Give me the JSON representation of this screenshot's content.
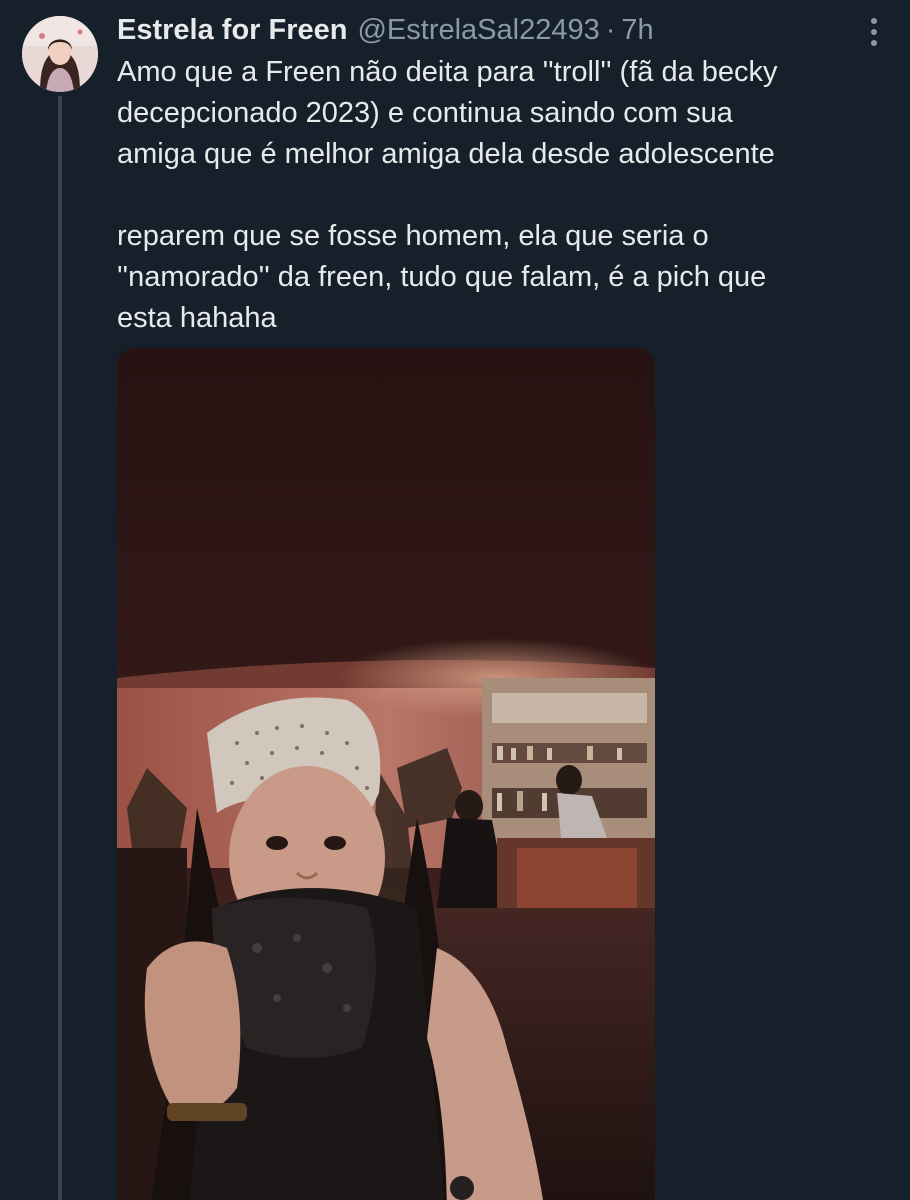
{
  "tweet": {
    "author": {
      "display_name": "Estrela for Freen",
      "handle": "@EstrelaSal22493",
      "separator": "·",
      "time": "7h"
    },
    "text_lines": [
      "Amo que a Freen não deita para ''troll'' (fã da becky",
      "decepcionado 2023) e continua saindo com sua",
      "amiga que é melhor amiga dela desde adolescente",
      "reparem que se fosse homem, ela que seria o",
      "''namorado'' da freen, tudo que falam, é a pich que",
      "esta hahaha"
    ],
    "icons": {
      "more": "more-options-icon",
      "avatar": "avatar-image"
    }
  },
  "colors": {
    "background": "#15202b",
    "text_primary": "#e7e9ea",
    "text_secondary": "#8b98a5",
    "thread_line": "#38444d"
  }
}
